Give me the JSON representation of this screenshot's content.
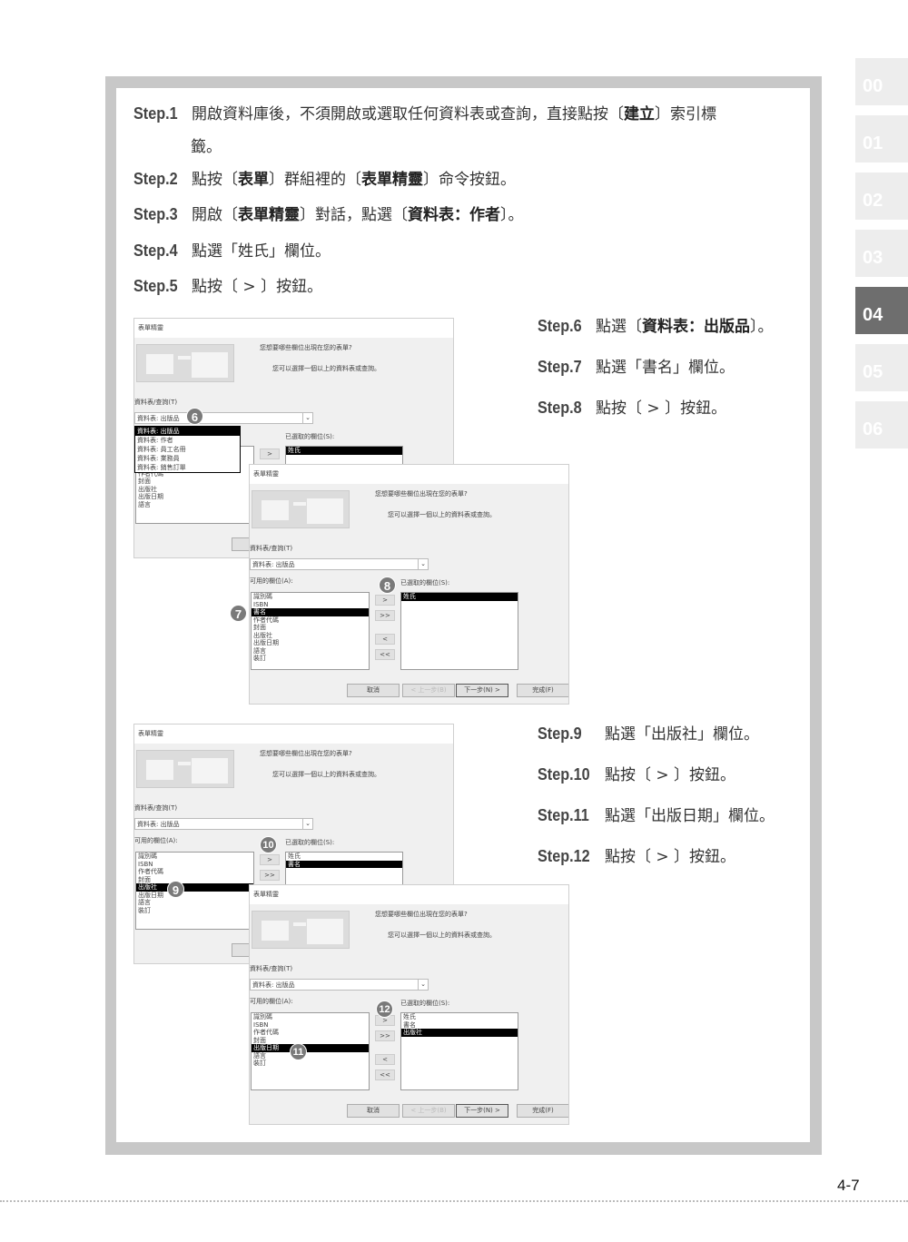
{
  "chapter_tabs": [
    {
      "label": "00",
      "active": false
    },
    {
      "label": "01",
      "active": false
    },
    {
      "label": "02",
      "active": false
    },
    {
      "label": "03",
      "active": false
    },
    {
      "label": "04",
      "active": true
    },
    {
      "label": "05",
      "active": false
    },
    {
      "label": "06",
      "active": false
    }
  ],
  "steps": [
    {
      "label": "Step.1",
      "parts": [
        {
          "t": "開啟資料庫後，不須開啟或選取任何資料表或查詢，直接點按〔"
        },
        {
          "t": "建立",
          "b": true
        },
        {
          "t": "〕索引標"
        }
      ],
      "continuation": "籤。"
    },
    {
      "label": "Step.2",
      "parts": [
        {
          "t": "點按〔"
        },
        {
          "t": "表單",
          "b": true
        },
        {
          "t": "〕群組裡的〔"
        },
        {
          "t": "表單精靈",
          "b": true
        },
        {
          "t": "〕命令按鈕。"
        }
      ]
    },
    {
      "label": "Step.3",
      "parts": [
        {
          "t": "開啟〔"
        },
        {
          "t": "表單精靈",
          "b": true
        },
        {
          "t": "〕對話，點選〔"
        },
        {
          "t": "資料表：作者",
          "b": true
        },
        {
          "t": "〕。"
        }
      ]
    },
    {
      "label": "Step.4",
      "parts": [
        {
          "t": "點選「姓氏」欄位。"
        }
      ]
    },
    {
      "label": "Step.5",
      "parts": [
        {
          "t": "點按〔 > 〕按鈕。"
        }
      ]
    },
    {
      "label": "Step.6",
      "parts": [
        {
          "t": "點選〔"
        },
        {
          "t": "資料表：出版品",
          "b": true
        },
        {
          "t": "〕。"
        }
      ]
    },
    {
      "label": "Step.7",
      "parts": [
        {
          "t": "點選「書名」欄位。"
        }
      ]
    },
    {
      "label": "Step.8",
      "parts": [
        {
          "t": "點按〔 > 〕按鈕。"
        }
      ]
    },
    {
      "label": "Step.9",
      "parts": [
        {
          "t": "點選「出版社」欄位。"
        }
      ]
    },
    {
      "label": "Step.10",
      "parts": [
        {
          "t": "點按〔 > 〕按鈕。"
        }
      ]
    },
    {
      "label": "Step.11",
      "parts": [
        {
          "t": "點選「出版日期」欄位。"
        }
      ]
    },
    {
      "label": "Step.12",
      "parts": [
        {
          "t": "點按〔 > 〕按鈕。"
        }
      ]
    }
  ],
  "dialog_common": {
    "title": "表單精靈",
    "question": "您想要哪些欄位出現在您的表單?",
    "hint": "您可以選擇一個以上的資料表或查詢。",
    "table_label": "資料表/查詢(T)",
    "available_label": "可用的欄位(A):",
    "selected_label": "已選取的欄位(S):",
    "move_buttons": [
      ">",
      ">>",
      "<",
      "<<"
    ],
    "cancel": "取消",
    "back": "< 上一步(B)",
    "next": "下一步(N) >",
    "finish": "完成(F)"
  },
  "dialogs": [
    {
      "combo": "資料表: 出版品",
      "available": [
        "識別碼",
        "ISBN",
        "書名",
        "作者代碼",
        "封面",
        "出版社",
        "出版日期",
        "語言"
      ],
      "available_selected": -1,
      "selected": [
        "姓氏"
      ],
      "selected_index": 0,
      "dropdown": [
        "資料表: 出版品",
        "資料表: 作者",
        "資料表: 員工名冊",
        "資料表: 業務員",
        "資料表: 銷售訂單"
      ],
      "dropdown_selected": 0
    },
    {
      "combo": "資料表: 出版品",
      "available": [
        "識別碼",
        "ISBN",
        "書名",
        "作者代碼",
        "封面",
        "出版社",
        "出版日期",
        "語言",
        "裝訂"
      ],
      "available_selected": 2,
      "selected": [
        "姓氏"
      ],
      "selected_index": 0
    },
    {
      "combo": "資料表: 出版品",
      "available": [
        "識別碼",
        "ISBN",
        "作者代碼",
        "封面",
        "出版社",
        "出版日期",
        "語言",
        "裝訂"
      ],
      "available_selected": 4,
      "selected": [
        "姓氏",
        "書名"
      ],
      "selected_index": 1
    },
    {
      "combo": "資料表: 出版品",
      "available": [
        "識別碼",
        "ISBN",
        "作者代碼",
        "封面",
        "出版日期",
        "語言",
        "裝訂"
      ],
      "available_selected": 4,
      "selected": [
        "姓氏",
        "書名",
        "出版社"
      ],
      "selected_index": 2
    }
  ],
  "badges": [
    "6",
    "7",
    "8",
    "9",
    "10",
    "11",
    "12"
  ],
  "page_number": "4-7"
}
